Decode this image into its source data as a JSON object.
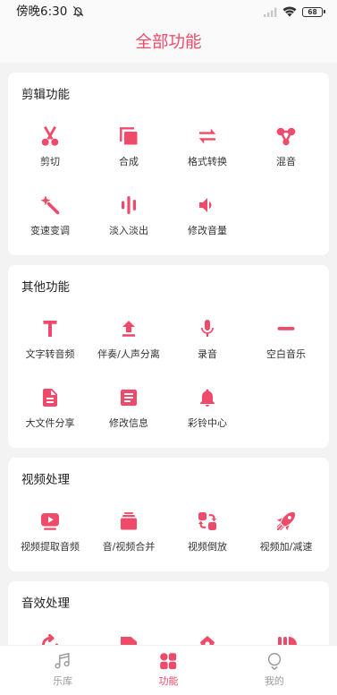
{
  "status_bar": {
    "time": "傍晚6:30",
    "battery": "68",
    "icons": [
      "alarm-off-icon",
      "signal-icon",
      "wifi-icon",
      "battery-icon"
    ]
  },
  "header": {
    "title": "全部功能"
  },
  "colors": {
    "accent": "#f04a6b",
    "background": "#f3f3f3",
    "card": "#ffffff",
    "label_text": "#333333",
    "nav_inactive": "#9a9a9a"
  },
  "sections": [
    {
      "title": "剪辑功能",
      "items": [
        {
          "label": "剪切",
          "icon": "scissors-icon"
        },
        {
          "label": "合成",
          "icon": "layers-icon"
        },
        {
          "label": "格式转换",
          "icon": "swap-arrows-icon"
        },
        {
          "label": "混音",
          "icon": "molecule-icon"
        },
        {
          "label": "变速变调",
          "icon": "magic-wand-icon"
        },
        {
          "label": "淡入淡出",
          "icon": "sound-bars-icon"
        },
        {
          "label": "修改音量",
          "icon": "speaker-icon"
        }
      ]
    },
    {
      "title": "其他功能",
      "items": [
        {
          "label": "文字转音频",
          "icon": "text-icon"
        },
        {
          "label": "伴奏/人声分离",
          "icon": "upload-icon"
        },
        {
          "label": "录音",
          "icon": "microphone-icon"
        },
        {
          "label": "空白音乐",
          "icon": "minus-icon"
        },
        {
          "label": "大文件分享",
          "icon": "document-icon"
        },
        {
          "label": "修改信息",
          "icon": "article-icon"
        },
        {
          "label": "彩铃中心",
          "icon": "bell-icon"
        }
      ]
    },
    {
      "title": "视频处理",
      "items": [
        {
          "label": "视频提取音频",
          "icon": "video-play-icon"
        },
        {
          "label": "音/视频合并",
          "icon": "stacked-video-icon"
        },
        {
          "label": "视频倒放",
          "icon": "swap-squares-icon"
        },
        {
          "label": "视频加/减速",
          "icon": "rocket-icon"
        }
      ]
    },
    {
      "title": "音效处理",
      "items": [
        {
          "icon": "circular-arrow-icon"
        },
        {
          "icon": "square-icon"
        },
        {
          "icon": "diamond-icon"
        },
        {
          "icon": "bars-icon"
        }
      ]
    }
  ],
  "bottom_nav": {
    "items": [
      {
        "label": "乐库",
        "icon": "music-note-icon",
        "active": false
      },
      {
        "label": "功能",
        "icon": "grid-icon",
        "active": true
      },
      {
        "label": "我的",
        "icon": "profile-icon",
        "active": false
      }
    ]
  }
}
